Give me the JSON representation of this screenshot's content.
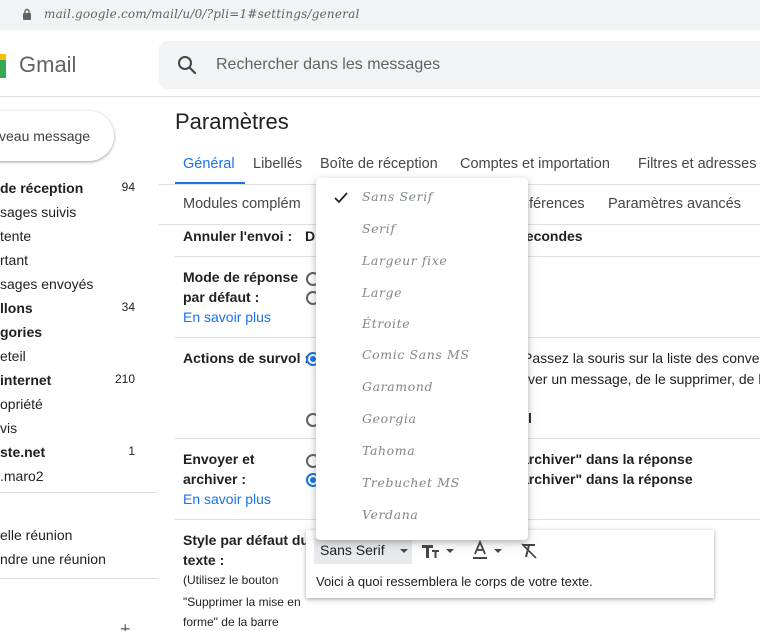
{
  "browser": {
    "url": "mail.google.com/mail/u/0/?pli=1#settings/general"
  },
  "header": {
    "app_name": "Gmail",
    "search_placeholder": "Rechercher dans les messages"
  },
  "sidebar": {
    "compose_label": "veau message",
    "items": [
      {
        "label": "de réception",
        "count": "94",
        "bold": true
      },
      {
        "label": "sages suivis",
        "count": "",
        "bold": false
      },
      {
        "label": "tente",
        "count": "",
        "bold": false
      },
      {
        "label": "rtant",
        "count": "",
        "bold": false
      },
      {
        "label": "sages envoyés",
        "count": "",
        "bold": false
      },
      {
        "label": "llons",
        "count": "34",
        "bold": true
      },
      {
        "label": "gories",
        "count": "",
        "bold": true
      },
      {
        "label": "eteil",
        "count": "",
        "bold": false
      },
      {
        "label": "internet",
        "count": "210",
        "bold": true
      },
      {
        "label": "opriété",
        "count": "",
        "bold": false
      },
      {
        "label": "vis",
        "count": "",
        "bold": false
      },
      {
        "label": "ste.net",
        "count": "1",
        "bold": true
      },
      {
        "label": ".maro2",
        "count": "",
        "bold": false
      }
    ],
    "meet_items": [
      "elle réunion",
      "ndre une réunion"
    ],
    "plus": "+"
  },
  "main": {
    "title": "Paramètres",
    "tabs": [
      "Général",
      "Libellés",
      "Boîte de réception",
      "Comptes et importation",
      "Filtres et adresses"
    ],
    "tabs_row2": [
      "Modules complém",
      "nférences",
      "Paramètres avancés"
    ],
    "undo_send": {
      "label": "Annuler l'envoi :",
      "value_left": "D",
      "value_right": "secondes"
    },
    "reply_mode": {
      "label_line1": "Mode de réponse",
      "label_line2": "par défaut :",
      "link": "En savoir plus"
    },
    "hover_actions": {
      "label": "Actions de survol :",
      "text_line1": "Passez la souris sur la liste des conve",
      "text_line2": "ver un message, de le supprimer, de l",
      "text_line3": "l"
    },
    "send_archive": {
      "label_line1": "Envoyer et",
      "label_line2": "archiver :",
      "link": "En savoir plus",
      "opt1": "archiver\" dans la réponse",
      "opt2": "archiver\" dans la réponse"
    },
    "text_style": {
      "label_line1": "Style par défaut du",
      "label_line2": "texte :",
      "note_line1": "(Utilisez le bouton",
      "note_line2": "\"Supprimer la mise en",
      "note_line3": "forme\" de la barre",
      "font_selected": "Sans Serif",
      "preview": "Voici à quoi ressemblera le corps de votre texte."
    }
  },
  "font_menu": {
    "selected_index": 0,
    "options": [
      "Sans Serif",
      "Serif",
      "Largeur fixe",
      "Large",
      "Étroite",
      "Comic Sans MS",
      "Garamond",
      "Georgia",
      "Tahoma",
      "Trebuchet MS",
      "Verdana"
    ]
  },
  "colors": {
    "accent": "#1a73e8",
    "text": "#202124",
    "muted": "#5f6368",
    "divider": "#e0e0e0"
  }
}
